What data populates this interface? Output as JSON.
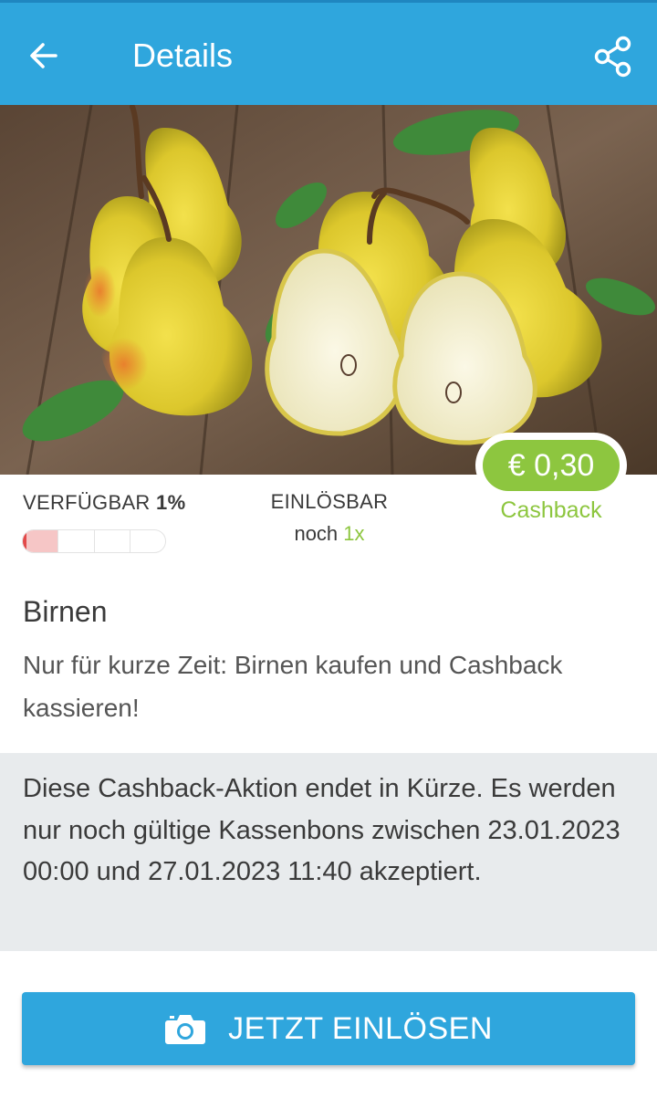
{
  "header": {
    "title": "Details",
    "back_icon": "arrow-left-icon",
    "share_icon": "share-icon",
    "background": "#2fa6dd"
  },
  "hero_image": {
    "subject": "pears"
  },
  "offer": {
    "price": "€ 0,30",
    "price_label": "Cashback",
    "accent_color": "#8dc63f"
  },
  "availability": {
    "label": "VERFÜGBAR",
    "value": "1%",
    "percent": 1,
    "segments": 4
  },
  "redeemable": {
    "label": "EINLÖSBAR",
    "prefix": "noch",
    "count": "1x"
  },
  "product": {
    "title": "Birnen",
    "description": "Nur für kurze Zeit: Birnen kaufen und Cashback kassieren!"
  },
  "notice": {
    "text": "Diese Cashback-Aktion endet in Kürze. Es werden nur noch gültige Kassenbons zwischen 23.01.2023 00:00 und 27.01.2023 11:40 akzeptiert."
  },
  "cta": {
    "label": "JETZT EINLÖSEN",
    "icon": "camera-icon"
  }
}
